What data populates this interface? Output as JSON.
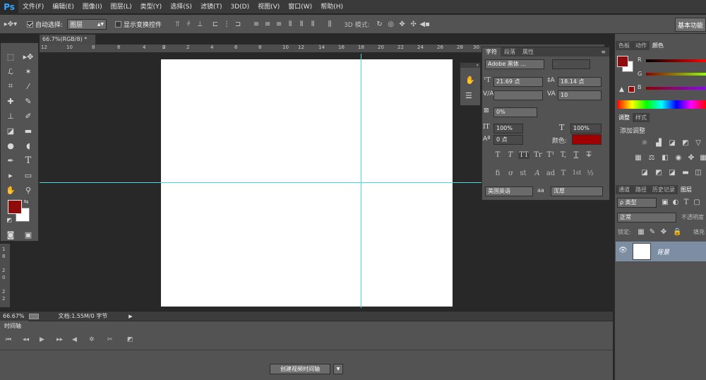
{
  "app": {
    "logo": "Ps"
  },
  "menu": [
    "文件(F)",
    "编辑(E)",
    "图像(I)",
    "图层(L)",
    "类型(Y)",
    "选择(S)",
    "滤镜(T)",
    "3D(D)",
    "视图(V)",
    "窗口(W)",
    "帮助(H)"
  ],
  "options": {
    "auto_select_label": "自动选择:",
    "auto_select_value": "图层",
    "show_transform_label": "显示变换控件",
    "mode_3d_label": "3D 模式:",
    "workspace": "基本功能"
  },
  "document": {
    "tab_label": "66.7%(RGB/8) *",
    "ruler_marks": [
      "12",
      "10",
      "8",
      "6",
      "4",
      "2",
      "0",
      "2",
      "4",
      "6",
      "8",
      "10",
      "12",
      "14",
      "16",
      "18",
      "20",
      "22",
      "24",
      "26",
      "28",
      "30"
    ],
    "vruler_marks": [
      "1",
      "8",
      "2",
      "0",
      "2",
      "2"
    ]
  },
  "status": {
    "zoom": "66.67%",
    "doc_size": "文档:1.55M/0 字节"
  },
  "timeline": {
    "tab": "时间轴",
    "create_button": "创建视频时间轴"
  },
  "character_panel": {
    "tabs": [
      "字符",
      "段落",
      "属性"
    ],
    "font_family": "Adobe 黑体 ...",
    "font_style": "-",
    "font_size": "21.69 点",
    "leading": "18.14 点",
    "kerning": "",
    "tracking": "10",
    "tsume": "0%",
    "vertical_scale": "100%",
    "horizontal_scale": "100%",
    "baseline_shift": "0 点",
    "color_label": "颜色:",
    "text_color": "#a00000",
    "style_buttons": [
      "T",
      "T",
      "TT",
      "Tr",
      "T¹",
      "T,",
      "T",
      "T"
    ],
    "opentype_buttons": [
      "fi",
      "ơ",
      "st",
      "A",
      "ad",
      "T",
      "1st",
      "½"
    ],
    "language": "美国英语",
    "aa_label": "aa",
    "antialias": "浑厚"
  },
  "right_panels": {
    "color_tabs": [
      "色板",
      "动作",
      "颜色"
    ],
    "color_channels": [
      "R",
      "G",
      "B"
    ],
    "adjust_tabs": [
      "调整",
      "样式"
    ],
    "adjust_title": "添加调整",
    "layers_tabs": [
      "通道",
      "路径",
      "历史记录",
      "图层"
    ],
    "kind_filter": "ρ 类型",
    "blend_mode": "正常",
    "opacity_label": "不透明度",
    "lock_label": "锁定:",
    "fill_label": "填充",
    "layer_name": "背景"
  },
  "colors": {
    "foreground": "#8f0c0c",
    "background": "#ffffff",
    "guide": "#4fd8dc",
    "accent": "#31a8ff"
  }
}
